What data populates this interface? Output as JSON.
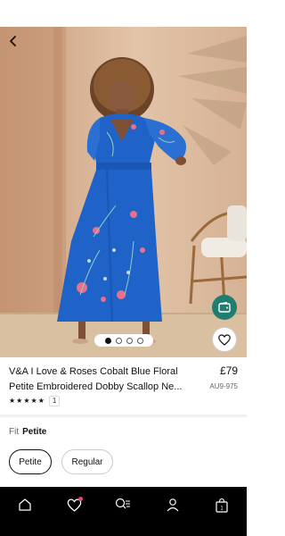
{
  "product": {
    "title_line1": "V&A I Love & Roses Cobalt Blue Floral",
    "title_line2": "Petite Embroidered Dobby Scallop Ne...",
    "price": "£79",
    "sku": "AU9-975",
    "rating_stars": 5,
    "rating_count": "1"
  },
  "gallery": {
    "image_count": 4,
    "active_index": 0
  },
  "fit": {
    "label": "Fit",
    "selected": "Petite",
    "options": [
      "Petite",
      "Regular"
    ]
  },
  "tabbar": {
    "items": [
      "home-icon",
      "heart-icon",
      "search-menu-icon",
      "account-icon",
      "bag-icon"
    ],
    "bag_count": "1"
  },
  "colors": {
    "dress_blue": "#1f62c8",
    "wallet_green": "#1f7e70",
    "tabbar_bg": "#000000",
    "wishlist_dot": "#e0447b"
  }
}
